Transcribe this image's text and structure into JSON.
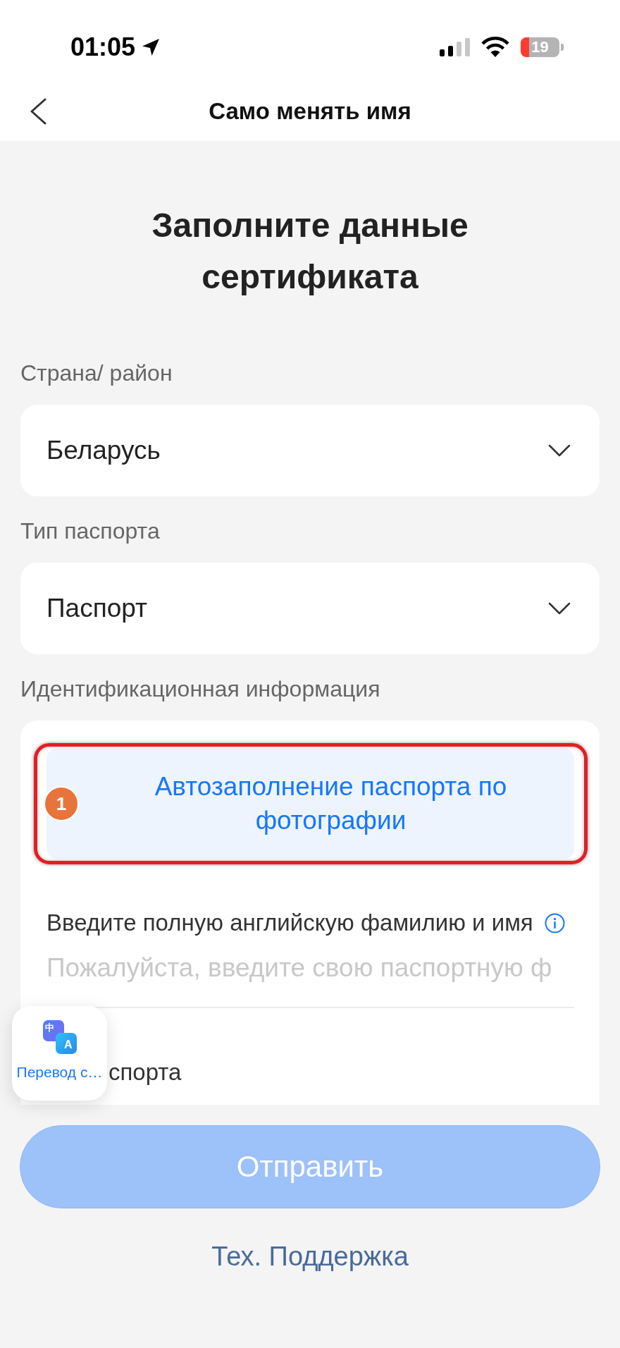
{
  "status_bar": {
    "time": "01:05",
    "battery": "19"
  },
  "nav": {
    "title": "Само менять имя"
  },
  "heading": "Заполните данные сертификата",
  "selects": [
    {
      "label": "Страна/ район",
      "value": "Беларусь"
    },
    {
      "label": "Тип паспорта",
      "value": "Паспорт"
    }
  ],
  "identity": {
    "label": "Идентификационная информация",
    "autofill_button": "Автозаполнение паспорта по фотографии",
    "annotation": {
      "number": "1"
    },
    "fields": [
      {
        "label": "Введите полную английскую фамилию и имя",
        "info": true,
        "placeholder": "Пожалуйста, введите свою паспортную ф"
      },
      {
        "label": "спорта",
        "info": false
      }
    ]
  },
  "translate_widget": {
    "label": "Перевод с…",
    "glyphs": [
      "中",
      "A"
    ]
  },
  "submit": {
    "label": "Отправить",
    "disabled": true
  },
  "support_link": "Тех. Поддержка"
}
